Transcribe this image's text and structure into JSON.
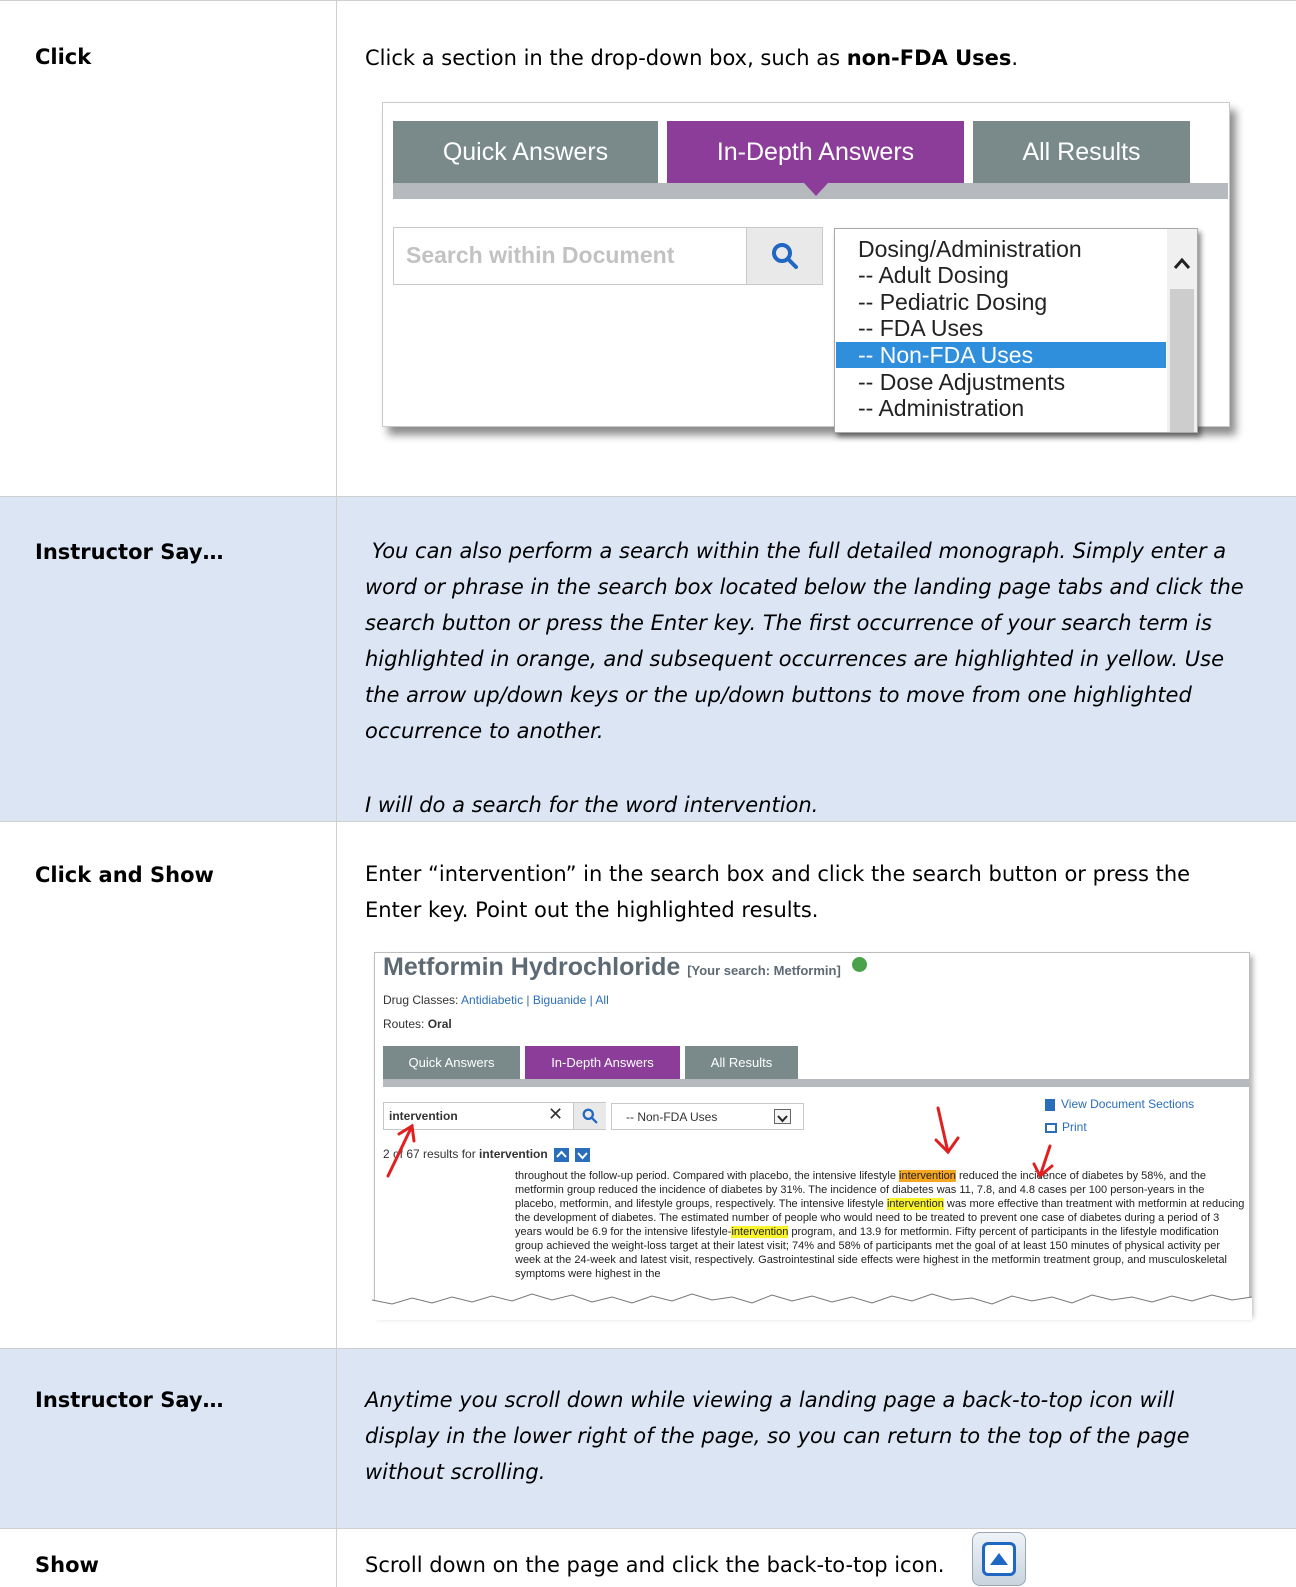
{
  "rows": [
    {
      "label": "Click",
      "text_before": "Click a section in the drop-down box, such as ",
      "text_bold": "non-FDA Uses",
      "text_after": "."
    },
    {
      "label": "Instructor Say…",
      "paragraph1": " You can also perform a search within the full detailed monograph. Simply enter a word or phrase in the search box located below the landing page tabs and click the search button or press the Enter key. The first occurrence of your search term is highlighted in orange, and subsequent occurrences are highlighted in yellow. Use the arrow up/down keys or the up/down buttons to move from one highlighted occurrence to another.",
      "paragraph2": "I will do a search for the word intervention."
    },
    {
      "label": "Click and Show",
      "text": "Enter “intervention” in the search box and click the search button or press the Enter key. Point out the highlighted results."
    },
    {
      "label": "Instructor Say…",
      "text": "Anytime you scroll down while viewing a landing page a back-to-top icon will display in the lower right of the page, so you can return to the top of the page without scrolling."
    },
    {
      "label": "Show",
      "text": "Scroll down on the page and click the back-to-top icon."
    }
  ],
  "screenshot1": {
    "tabs": [
      "Quick Answers",
      "In-Depth Answers",
      "All Results"
    ],
    "active_tab": "In-Depth Answers",
    "search_placeholder": "Search within Document",
    "search_icon": "search-icon",
    "dropdown_options": [
      "Dosing/Administration",
      "-- Adult Dosing",
      "-- Pediatric Dosing",
      "-- FDA Uses",
      "-- Non-FDA Uses",
      "-- Dose Adjustments",
      "-- Administration"
    ],
    "selected_option": "-- Non-FDA Uses",
    "colors": {
      "tab_gray": "#7a8a8a",
      "tab_purple": "#8c3d9a",
      "selected_blue": "#2f8fdc"
    }
  },
  "screenshot2": {
    "title": "Metformin Hydrochloride",
    "your_search": "[Your search:  Metformin]",
    "drug_classes_label": "Drug Classes:",
    "drug_classes": [
      "Antidiabetic",
      "Biguanide",
      "All"
    ],
    "routes_label": "Routes:",
    "routes_value": "Oral",
    "tabs": [
      "Quick Answers",
      "In-Depth Answers",
      "All Results"
    ],
    "search_value": "intervention",
    "section_select": "-- Non-FDA Uses",
    "results_prefix": "2 of 67 results for ",
    "results_term": "intervention",
    "view_sections": "View Document Sections",
    "print": "Print",
    "doc": {
      "l1a": "throughout the follow-up period. Compared with placebo, the intensive lifestyle ",
      "l1h": "intervention",
      "l1b": " reduced the incidence of diabetes by 58%, and the metformin group reduced the incidence of diabetes by 31%. The incidence of diabetes was 11, 7.8, and 4.8 cases per 100 person-years in the placebo, metformin, and lifestyle groups, respectively. The intensive lifestyle ",
      "l2h": "intervention",
      "l2b": " was more effective than treatment with metformin at reducing the development of diabetes. The estimated number of people who would need to be treated to prevent one case of diabetes during a period of 3 years would be 6.9 for the intensive lifestyle-",
      "l3h": "intervention",
      "l3b": " program, and 13.9 for metformin. Fifty percent of participants in the lifestyle modification group achieved the weight-loss target at their latest visit; 74% and 58% of participants met the goal of at least 150 minutes of physical activity per week at the 24-week and latest visit, respectively. Gastrointestinal side effects were highest in the metformin treatment group, and musculoskeletal symptoms were highest in the"
    }
  },
  "back_to_top_icon": "back-to-top-icon"
}
